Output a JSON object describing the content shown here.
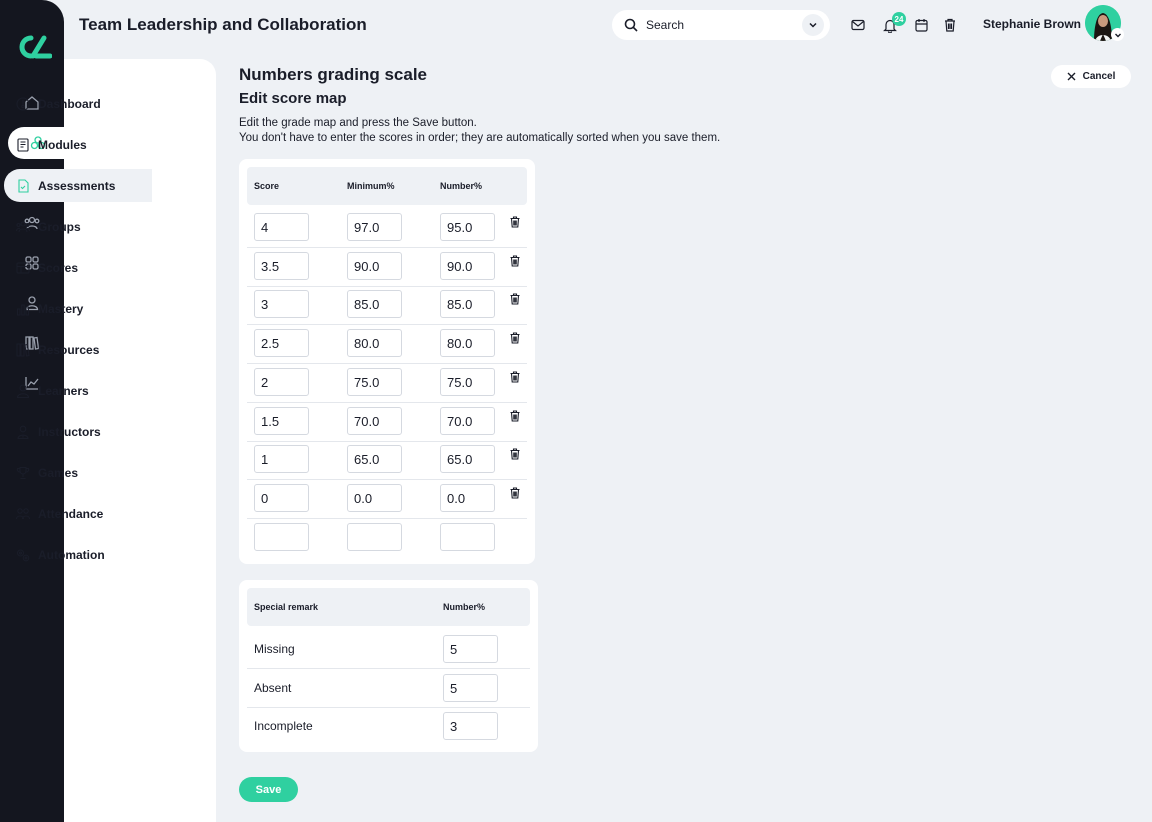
{
  "app": {
    "title": "Team Leadership and Collaboration"
  },
  "search": {
    "placeholder": "Search"
  },
  "notifications": {
    "count": "24"
  },
  "user": {
    "name": "Stephanie Brown"
  },
  "rail": {
    "items": [
      {
        "icon": "home-icon"
      },
      {
        "icon": "modules-icon",
        "active": true
      },
      {
        "icon": "target-icon"
      },
      {
        "icon": "people-icon"
      },
      {
        "icon": "grid-icon"
      },
      {
        "icon": "user-icon"
      },
      {
        "icon": "library-icon"
      },
      {
        "icon": "chart-icon"
      }
    ]
  },
  "subnav": {
    "items": [
      {
        "label": "Dashboard",
        "icon": "dashboard-icon"
      },
      {
        "label": "Modules",
        "icon": "book-icon"
      },
      {
        "label": "Assessments",
        "icon": "document-icon",
        "active": true
      },
      {
        "label": "Groups",
        "icon": "groups-icon"
      },
      {
        "label": "Scores",
        "icon": "table-icon"
      },
      {
        "label": "Mastery",
        "icon": "bar-chart-icon"
      },
      {
        "label": "Resources",
        "icon": "books-icon"
      },
      {
        "label": "Learners",
        "icon": "learner-icon"
      },
      {
        "label": "Instructors",
        "icon": "instructor-icon"
      },
      {
        "label": "Games",
        "icon": "trophy-icon"
      },
      {
        "label": "Attendance",
        "icon": "attendance-icon"
      },
      {
        "label": "Automation",
        "icon": "gears-icon"
      }
    ]
  },
  "page": {
    "title": "Numbers grading scale",
    "subtitle": "Edit score map",
    "instructions": [
      "Edit the grade map and press the Save button.",
      "You don't have to enter the scores in order; they are automatically sorted when you save them."
    ],
    "cancel_label": "Cancel",
    "save_label": "Save"
  },
  "score_table": {
    "headers": {
      "score": "Score",
      "minimum": "Minimum%",
      "number": "Number%"
    },
    "rows": [
      {
        "score": "4",
        "minimum": "97.0",
        "number": "95.0"
      },
      {
        "score": "3.5",
        "minimum": "90.0",
        "number": "90.0"
      },
      {
        "score": "3",
        "minimum": "85.0",
        "number": "85.0"
      },
      {
        "score": "2.5",
        "minimum": "80.0",
        "number": "80.0"
      },
      {
        "score": "2",
        "minimum": "75.0",
        "number": "75.0"
      },
      {
        "score": "1.5",
        "minimum": "70.0",
        "number": "70.0"
      },
      {
        "score": "1",
        "minimum": "65.0",
        "number": "65.0"
      },
      {
        "score": "0",
        "minimum": "0.0",
        "number": "0.0"
      },
      {
        "score": "",
        "minimum": "",
        "number": ""
      }
    ]
  },
  "remarks_table": {
    "headers": {
      "remark": "Special remark",
      "number": "Number%"
    },
    "rows": [
      {
        "label": "Missing",
        "number": "5"
      },
      {
        "label": "Absent",
        "number": "5"
      },
      {
        "label": "Incomplete",
        "number": "3"
      }
    ]
  },
  "colors": {
    "accent": "#2fd0a0",
    "rail": "#14161f",
    "background": "#eef1f5"
  }
}
